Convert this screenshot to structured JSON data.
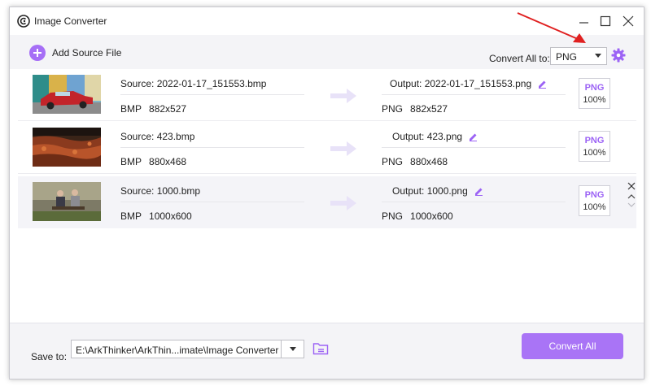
{
  "window": {
    "title": "Image Converter"
  },
  "toolbar": {
    "add_label": "Add Source File",
    "convert_all_to_label": "Convert All to:",
    "format_selected": "PNG"
  },
  "files": [
    {
      "source_name": "Source: 2022-01-17_151553.bmp",
      "source_format": "BMP",
      "source_size": "882x527",
      "output_name": "Output: 2022-01-17_151553.png",
      "output_format": "PNG",
      "output_size": "882x527",
      "badge_format": "PNG",
      "badge_quality": "100%"
    },
    {
      "source_name": "Source: 423.bmp",
      "source_format": "BMP",
      "source_size": "880x468",
      "output_name": "Output: 423.png",
      "output_format": "PNG",
      "output_size": "880x468",
      "badge_format": "PNG",
      "badge_quality": "100%"
    },
    {
      "source_name": "Source: 1000.bmp",
      "source_format": "BMP",
      "source_size": "1000x600",
      "output_name": "Output: 1000.png",
      "output_format": "PNG",
      "output_size": "1000x600",
      "badge_format": "PNG",
      "badge_quality": "100%"
    }
  ],
  "bottom": {
    "save_to_label": "Save to:",
    "path": "E:\\ArkThinker\\ArkThin...imate\\Image Converter",
    "convert_all_label": "Convert All"
  },
  "colors": {
    "accent": "#a974f6",
    "annotation": "#e02020"
  },
  "icons": [
    "app-logo-icon",
    "minimize-icon",
    "maximize-icon",
    "close-icon",
    "add-icon",
    "gear-icon",
    "arrow-right-icon",
    "edit-icon",
    "chevron-up-icon",
    "chevron-down-icon",
    "folder-icon"
  ]
}
